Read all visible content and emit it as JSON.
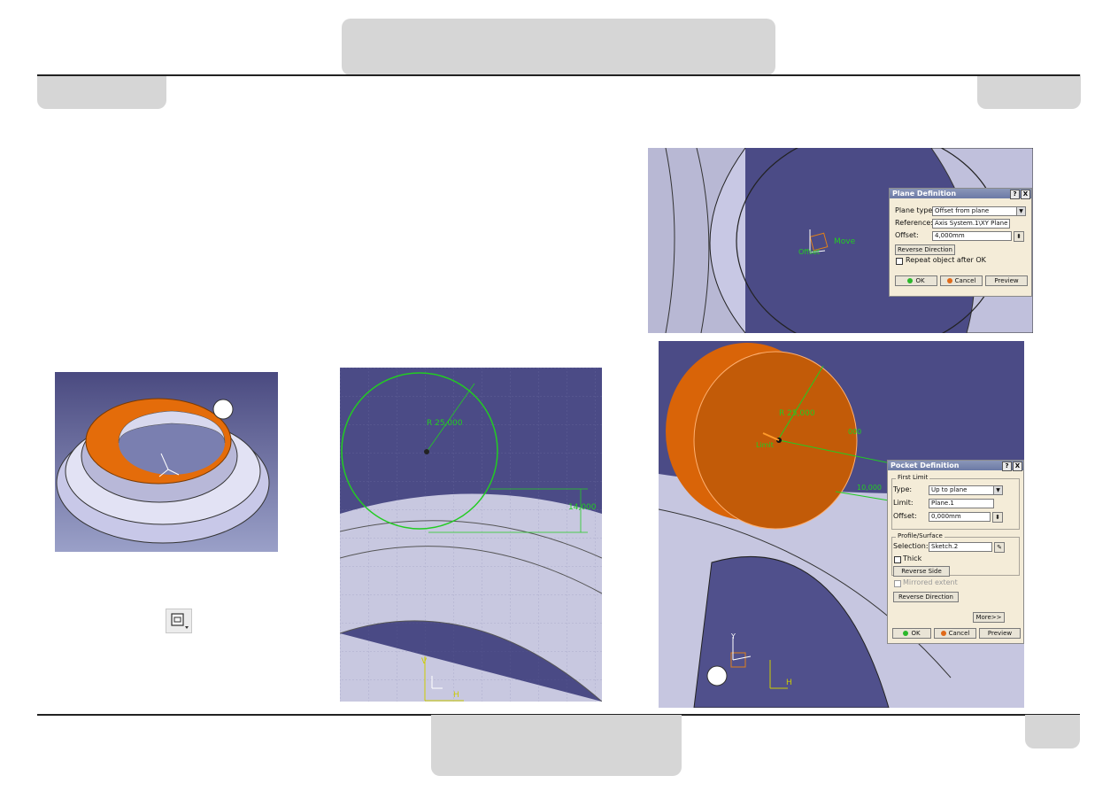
{
  "page": {
    "top_tab": "",
    "left_tab": "",
    "right_tab": "",
    "bottom_tab": "",
    "corner_tab": ""
  },
  "plane_dialog": {
    "title": "Plane Definition",
    "help": "?",
    "close": "X",
    "plane_type_label": "Plane type:",
    "plane_type_value": "Offset from plane",
    "reference_label": "Reference:",
    "reference_value": "Axis System.1\\XY Plane",
    "offset_label": "Offset:",
    "offset_value": "4,000mm",
    "reverse_button": "Reverse Direction",
    "repeat_label": "Repeat object after OK",
    "ok": "OK",
    "cancel": "Cancel",
    "preview": "Preview"
  },
  "plane_view": {
    "move_label": "Move",
    "offset_tag": "Offset"
  },
  "pocket_dialog": {
    "title": "Pocket Definition",
    "help": "?",
    "close": "X",
    "first_limit": "First Limit",
    "type_label": "Type:",
    "type_value": "Up to plane",
    "limit_label": "Limit:",
    "limit_value": "Plane.1",
    "offset_label": "Offset:",
    "offset_value": "0,000mm",
    "profile_group": "Profile/Surface",
    "selection_label": "Selection:",
    "selection_value": "Sketch.2",
    "thick_label": "Thick",
    "reverse_side": "Reverse Side",
    "mirrored_label": "Mirrored extent",
    "reverse_direction": "Reverse Direction",
    "more": "More>>",
    "ok": "OK",
    "cancel": "Cancel",
    "preview": "Preview"
  },
  "sketch_view": {
    "radius_label": "R 25,000",
    "dimension_label": "14,000"
  },
  "pocket_view": {
    "radius_label": "R 25,000",
    "dim_a": "000",
    "dim_b": "10,000",
    "limit_tag": "Limit"
  },
  "axis": {
    "y": "Y",
    "h": "H",
    "v": "V"
  },
  "colors": {
    "accent_orange": "#e8700a",
    "viewport_blue": "#45457a",
    "sketch_green": "#22cc22"
  }
}
